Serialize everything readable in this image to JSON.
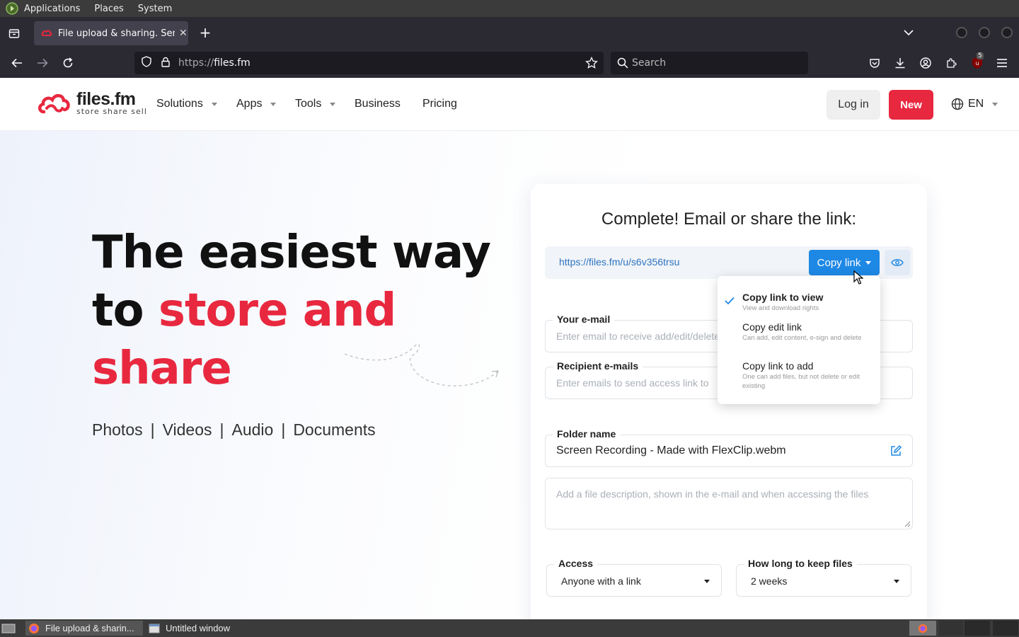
{
  "system_panel": {
    "menus": [
      "Applications",
      "Places",
      "System"
    ]
  },
  "browser": {
    "tab_title": "File upload & sharing. Send",
    "url_prefix": "https://",
    "url_host": "files.fm",
    "search_placeholder": "Search",
    "extension_badge": "5"
  },
  "header": {
    "brand_name": "files.fm",
    "brand_tagline": "store  share  sell",
    "nav": [
      {
        "label": "Solutions",
        "has_dropdown": true
      },
      {
        "label": "Apps",
        "has_dropdown": true
      },
      {
        "label": "Tools",
        "has_dropdown": true
      },
      {
        "label": "Business",
        "has_dropdown": false
      },
      {
        "label": "Pricing",
        "has_dropdown": false
      }
    ],
    "login_label": "Log in",
    "new_label": "New",
    "language": "EN"
  },
  "hero": {
    "line1": "The easiest way",
    "line2_plain": "to ",
    "line2_accent": "store and",
    "line3_accent": "share",
    "categories": [
      "Photos",
      "Videos",
      "Audio",
      "Documents"
    ],
    "separator": "|"
  },
  "share_card": {
    "title": "Complete! Email or share the link:",
    "share_url": "https://files.fm/u/s6v356trsu",
    "copy_button_label": "Copy link",
    "your_email_label": "Your e-mail",
    "your_email_placeholder": "Enter email to receive add/edit/delete links",
    "recipients_label": "Recipient e-mails",
    "recipients_placeholder": "Enter emails to send access link to",
    "folder_label": "Folder name",
    "folder_value": "Screen Recording - Made with FlexClip.webm",
    "description_placeholder": "Add a file description, shown in the e-mail and when accessing the files",
    "access_label": "Access",
    "access_value": "Anyone with a link",
    "keep_label": "How long to keep files",
    "keep_value": "2 weeks"
  },
  "copy_dropdown": {
    "items": [
      {
        "title": "Copy link to view",
        "desc": "View and download rights",
        "selected": true
      },
      {
        "title": "Copy edit link",
        "desc": "Can add, edit content, e-sign and delete",
        "selected": false
      },
      {
        "title": "Copy link to add",
        "desc": "One can add files, but not delete or edit existing",
        "selected": false
      }
    ]
  },
  "taskbar": {
    "tasks": [
      "File upload & sharin...",
      "Untitled window"
    ]
  },
  "colors": {
    "brand_red": "#e8283f",
    "primary_blue": "#1e88e5",
    "link_blue": "#2f74c0"
  }
}
